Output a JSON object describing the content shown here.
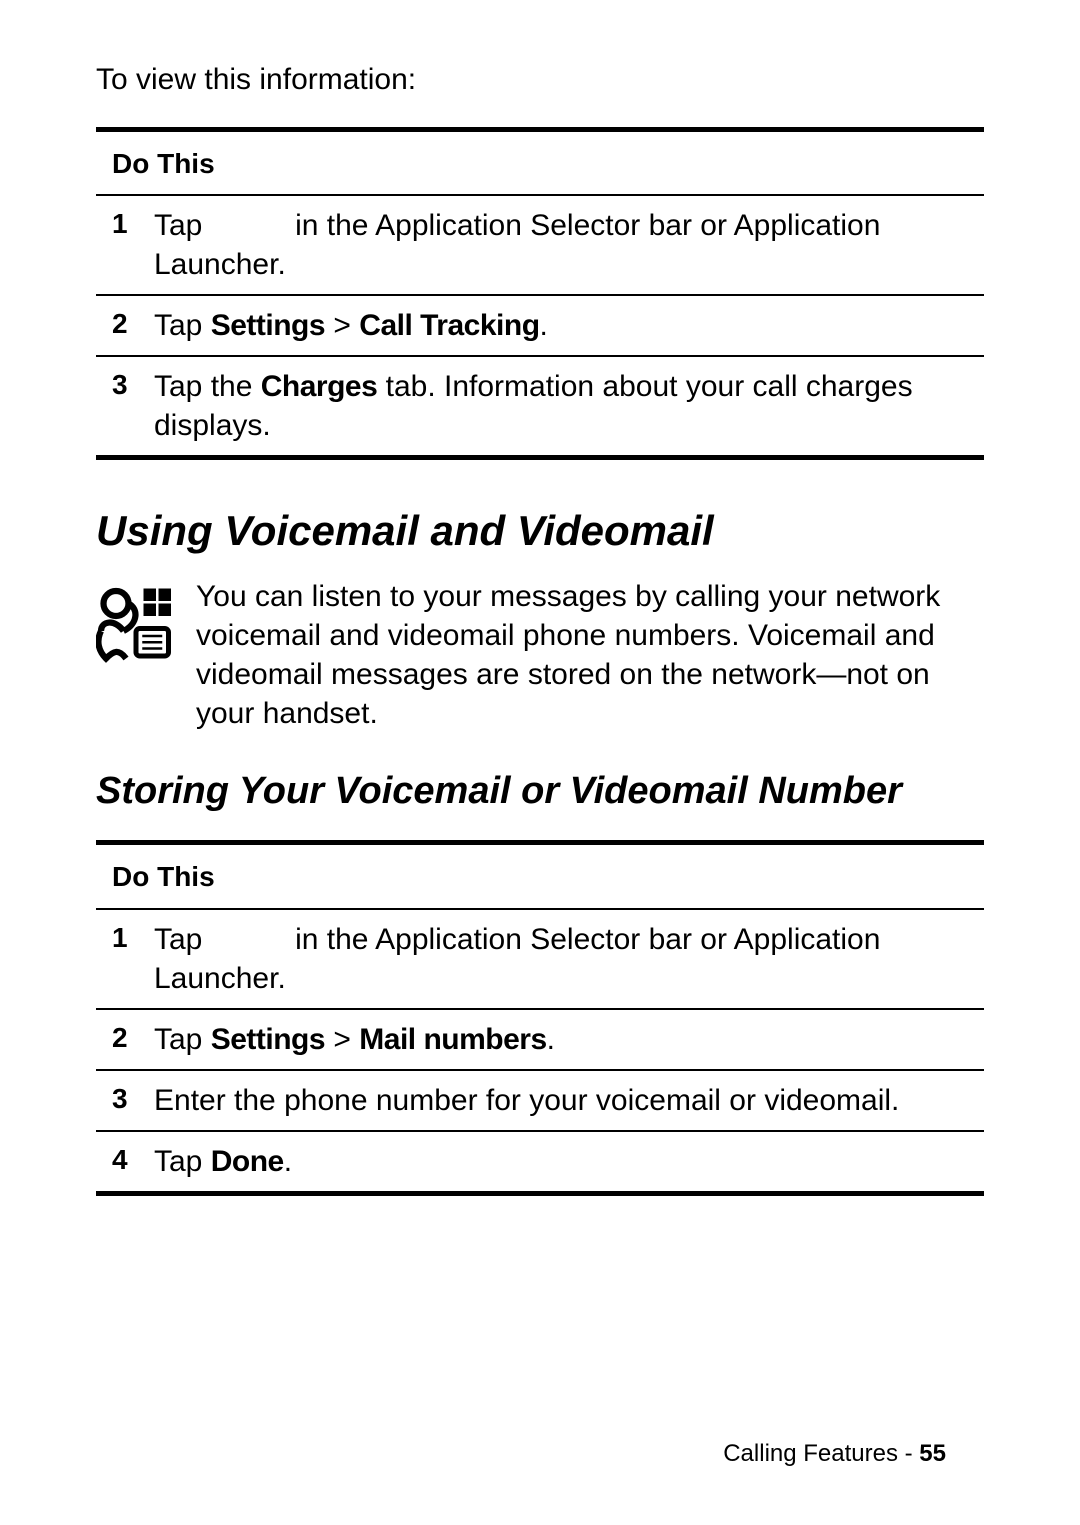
{
  "intro": "To view this information:",
  "table1": {
    "header": "Do This",
    "rows": [
      {
        "num": "1",
        "prefix": "Tap",
        "suffix": "in the Application Selector bar or Application Launcher."
      },
      {
        "num": "2",
        "t1": "Tap ",
        "b1": "Settings",
        "t2": " > ",
        "b2": "Call Tracking",
        "t3": "."
      },
      {
        "num": "3",
        "t1": "Tap the ",
        "b1": "Charges",
        "t2": " tab. Information about your call charges displays."
      }
    ]
  },
  "heading1": "Using Voicemail and Videomail",
  "vm_text": "You can listen to your messages by calling your network voicemail and videomail phone numbers. Voicemail and videomail messages are stored on the network—not on your handset.",
  "heading2": "Storing Your Voicemail or Videomail Number",
  "table2": {
    "header": "Do This",
    "rows": [
      {
        "num": "1",
        "prefix": "Tap",
        "suffix": "in the Application Selector bar or Application Launcher."
      },
      {
        "num": "2",
        "t1": "Tap ",
        "b1": "Settings",
        "t2": " > ",
        "b2": "Mail numbers",
        "t3": "."
      },
      {
        "num": "3",
        "text": "Enter the phone number for your voicemail or videomail."
      },
      {
        "num": "4",
        "t1": "Tap ",
        "b1": "Done",
        "t2": "."
      }
    ]
  },
  "footer": {
    "section": "Calling Features",
    "sep": " - ",
    "page": "55"
  }
}
